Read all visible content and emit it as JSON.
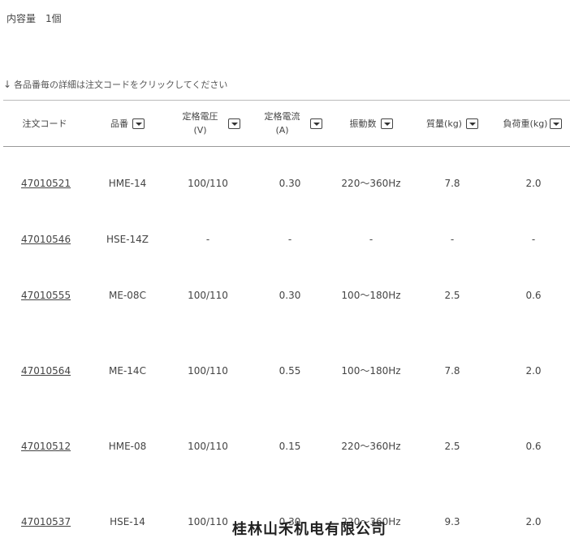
{
  "capacity": {
    "label": "内容量",
    "value": "1個"
  },
  "hint": "各品番毎の詳細は注文コードをクリックしてください",
  "columns": [
    {
      "label": "注文コード",
      "sortable": false
    },
    {
      "label": "品番",
      "sortable": true
    },
    {
      "label": "定格電圧",
      "unit": "(V)",
      "sortable": true
    },
    {
      "label": "定格電流",
      "unit": "(A)",
      "sortable": true
    },
    {
      "label": "振動数",
      "sortable": true
    },
    {
      "label": "質量(kg)",
      "sortable": true
    },
    {
      "label": "負荷重(kg)",
      "sortable": true
    }
  ],
  "rows": [
    {
      "code": "47010521",
      "model": "HME-14",
      "voltage": "100/110",
      "current": "0.30",
      "frequency": "220～360Hz",
      "mass": "7.8",
      "load": "2.0"
    },
    {
      "code": "47010546",
      "model": "HSE-14Z",
      "voltage": "-",
      "current": "-",
      "frequency": "-",
      "mass": "-",
      "load": "-"
    },
    {
      "code": "47010555",
      "model": "ME-08C",
      "voltage": "100/110",
      "current": "0.30",
      "frequency": "100～180Hz",
      "mass": "2.5",
      "load": "0.6"
    },
    {
      "code": "47010564",
      "model": "ME-14C",
      "voltage": "100/110",
      "current": "0.55",
      "frequency": "100～180Hz",
      "mass": "7.8",
      "load": "2.0"
    },
    {
      "code": "47010512",
      "model": "HME-08",
      "voltage": "100/110",
      "current": "0.15",
      "frequency": "220～360Hz",
      "mass": "2.5",
      "load": "0.6"
    },
    {
      "code": "47010537",
      "model": "HSE-14",
      "voltage": "100/110",
      "current": "0.30",
      "frequency": "220～360Hz",
      "mass": "9.3",
      "load": "2.0"
    }
  ],
  "watermark": "桂林山禾机电有限公司"
}
